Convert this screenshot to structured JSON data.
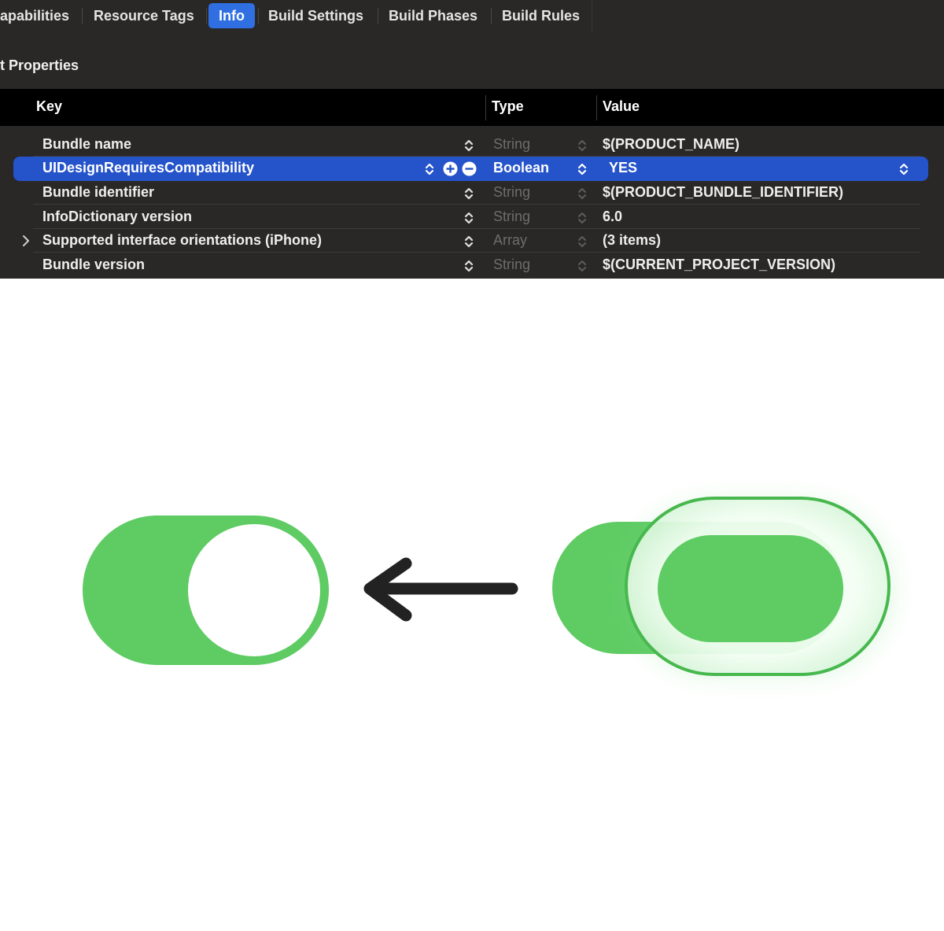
{
  "tabs": [
    {
      "label": "apabilities",
      "active": false
    },
    {
      "label": "Resource Tags",
      "active": false
    },
    {
      "label": "Info",
      "active": true
    },
    {
      "label": "Build Settings",
      "active": false
    },
    {
      "label": "Build Phases",
      "active": false
    },
    {
      "label": "Build Rules",
      "active": false
    }
  ],
  "section_title": "t Properties",
  "table": {
    "headers": {
      "key": "Key",
      "type": "Type",
      "value": "Value"
    },
    "rows": [
      {
        "key": "Bundle name",
        "type": "String",
        "value": "$(PRODUCT_NAME)",
        "selected": false,
        "expandable": false
      },
      {
        "key": "UIDesignRequiresCompatibility",
        "type": "Boolean",
        "value": "YES",
        "selected": true,
        "expandable": false
      },
      {
        "key": "Bundle identifier",
        "type": "String",
        "value": "$(PRODUCT_BUNDLE_IDENTIFIER)",
        "selected": false,
        "expandable": false
      },
      {
        "key": "InfoDictionary version",
        "type": "String",
        "value": "6.0",
        "selected": false,
        "expandable": false
      },
      {
        "key": "Supported interface orientations (iPhone)",
        "type": "Array",
        "value": "(3 items)",
        "selected": false,
        "expandable": true
      },
      {
        "key": "Bundle version",
        "type": "String",
        "value": "$(CURRENT_PROJECT_VERSION)",
        "selected": false,
        "expandable": false
      }
    ]
  },
  "icons": {
    "row_buttons": [
      "plus-circle-icon",
      "minus-circle-icon"
    ],
    "steppers": "up-down-chevron-icon",
    "disclosure": "chevron-right-icon",
    "arrow": "arrow-left-icon"
  },
  "colors": {
    "panel_bg": "#2a2826",
    "header_bg": "#000000",
    "accent_blue": "#2f6fe2",
    "selection_blue": "#2553c9",
    "toggle_green": "#5ecb63"
  },
  "illustration": {
    "left_toggle_state": "on",
    "right_toggle_state": "on"
  }
}
